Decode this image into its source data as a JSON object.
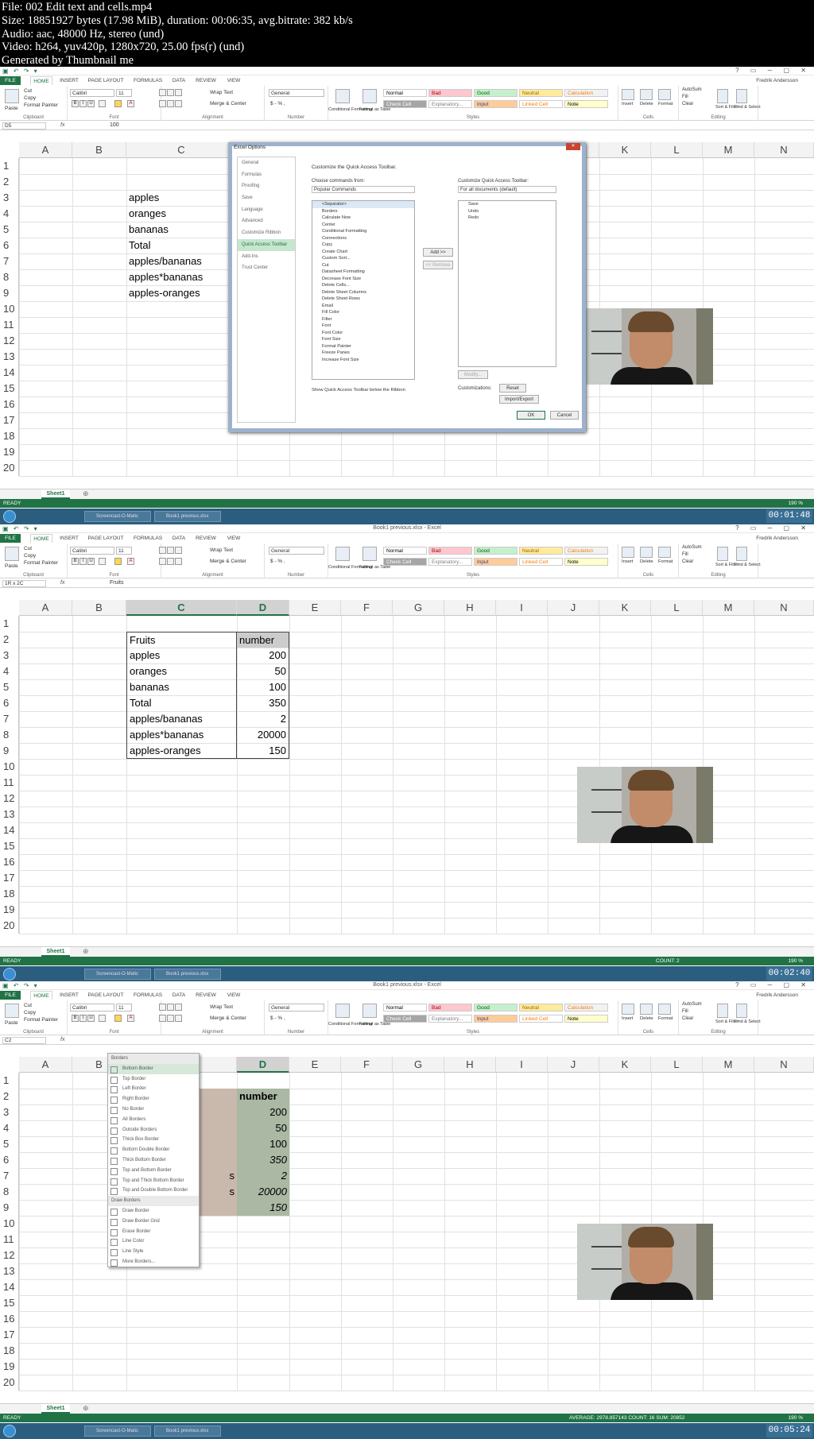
{
  "header": {
    "file": "File: 002 Edit text and cells.mp4",
    "size": "Size: 18851927 bytes (17.98 MiB), duration: 00:06:35, avg.bitrate: 382 kb/s",
    "audio": "Audio: aac, 48000 Hz, stereo (und)",
    "video": "Video: h264, yuv420p, 1280x720, 25.00 fps(r) (und)",
    "generated": "Generated by Thumbnail me"
  },
  "excel": {
    "tabs": [
      "FILE",
      "HOME",
      "INSERT",
      "PAGE LAYOUT",
      "FORMULAS",
      "DATA",
      "REVIEW",
      "VIEW"
    ],
    "user": "Fredrik Andersson",
    "title_f2": "Book1 previous.xlsx - Excel",
    "title_f3": "Book1 previous.xlsx - Excel",
    "font": "Calibri",
    "font_size": "11",
    "number_format": "General",
    "wrap_text": "Wrap Text",
    "merge_center": "Merge & Center",
    "styles": [
      "Normal",
      "Bad",
      "Good",
      "Neutral",
      "Calculation",
      "Check Cell",
      "Explanatory...",
      "Input",
      "Linked Cell",
      "Note"
    ],
    "clipboard": [
      "Cut",
      "Copy",
      "Format Painter"
    ],
    "cells_group": [
      "Insert",
      "Delete",
      "Format"
    ],
    "editing": [
      "AutoSum",
      "Fill",
      "Clear",
      "Sort & Filter",
      "Find & Select"
    ],
    "group_labels": [
      "Clipboard",
      "Font",
      "Alignment",
      "Number",
      "Styles",
      "Cells",
      "Editing"
    ],
    "cond_format": "Conditional Formatting",
    "format_table": "Format as Table",
    "paste": "Paste",
    "sheet": "Sheet1",
    "ready": "READY",
    "zoom": "190 %",
    "fx": "fx",
    "columns": [
      "A",
      "B",
      "C",
      "D",
      "E",
      "F",
      "G",
      "H",
      "I",
      "J",
      "K",
      "L",
      "M",
      "N"
    ],
    "rows": [
      "1",
      "2",
      "3",
      "4",
      "5",
      "6",
      "7",
      "8",
      "9",
      "10",
      "11",
      "12",
      "13",
      "14",
      "15",
      "16",
      "17",
      "18",
      "19",
      "20"
    ]
  },
  "frame1": {
    "namebox": "D5",
    "formula": "100",
    "cells_c": [
      "",
      "",
      "apples",
      "oranges",
      "bananas",
      "Total",
      "apples/bananas",
      "apples*bananas",
      "apples-oranges"
    ],
    "timestamp": "00:01:48",
    "dialog": {
      "title": "Excel Options",
      "nav": [
        "General",
        "Formulas",
        "Proofing",
        "Save",
        "Language",
        "Advanced",
        "Customize Ribbon",
        "Quick Access Toolbar",
        "Add-Ins",
        "Trust Center"
      ],
      "heading": "Customize the Quick Access Toolbar.",
      "choose_label": "Choose commands from:",
      "choose_value": "Popular Commands",
      "customize_label": "Customize Quick Access Toolbar:",
      "customize_value": "For all documents (default)",
      "commands": [
        "<Separator>",
        "Borders",
        "Calculate Now",
        "Center",
        "Conditional Formatting",
        "Connections",
        "Copy",
        "Create Chart",
        "Custom Sort...",
        "Cut",
        "Datasheet Formatting",
        "Decrease Font Size",
        "Delete Cells...",
        "Delete Sheet Columns",
        "Delete Sheet Rows",
        "Email",
        "Fill Color",
        "Filter",
        "Font",
        "Font Color",
        "Font Size",
        "Format Painter",
        "Freeze Panes",
        "Increase Font Size"
      ],
      "toolbar_items": [
        "Save",
        "Undo",
        "Redo"
      ],
      "add": "Add >>",
      "remove": "<< Remove",
      "modify": "Modify...",
      "customizations": "Customizations:",
      "reset": "Reset",
      "import_export": "Import/Export",
      "show_below": "Show Quick Access Toolbar below the Ribbon",
      "ok": "OK",
      "cancel": "Cancel"
    },
    "taskbar": [
      "Screencast-O-Matic",
      "Book1 previous.xlsx"
    ]
  },
  "frame2": {
    "namebox": "1R x 2C",
    "formula": "Fruits",
    "status_count": "COUNT: 2",
    "cells_c": [
      "",
      "Fruits",
      "apples",
      "oranges",
      "bananas",
      "Total",
      "apples/bananas",
      "apples*bananas",
      "apples-oranges"
    ],
    "cells_d": [
      "",
      "number",
      "200",
      "50",
      "100",
      "350",
      "2",
      "20000",
      "150"
    ],
    "timestamp": "00:02:40",
    "taskbar": [
      "Screencast-O-Matic",
      "Book1 previous.xlsx"
    ]
  },
  "frame3": {
    "namebox": "C2",
    "cells_d": [
      "",
      "number",
      "200",
      "50",
      "100",
      "350",
      "2",
      "20000",
      "150"
    ],
    "cells_c_partial": [
      "",
      "",
      "",
      "",
      "",
      "",
      "s",
      "s",
      ""
    ],
    "status_agg": "AVERAGE: 2978.857143    COUNT: 16    SUM: 20852",
    "timestamp": "00:05:24",
    "borders_menu": {
      "header": "Borders",
      "items": [
        "Bottom Border",
        "Top Border",
        "Left Border",
        "Right Border",
        "No Border",
        "All Borders",
        "Outside Borders",
        "Thick Box Border",
        "Bottom Double Border",
        "Thick Bottom Border",
        "Top and Bottom Border",
        "Top and Thick Bottom Border",
        "Top and Double Bottom Border"
      ],
      "draw_header": "Draw Borders",
      "draw_items": [
        "Draw Border",
        "Draw Border Grid",
        "Erase Border",
        "Line Color",
        "Line Style",
        "More Borders..."
      ]
    },
    "taskbar": [
      "Screencast-O-Matic",
      "Book1 previous.xlsx"
    ]
  }
}
